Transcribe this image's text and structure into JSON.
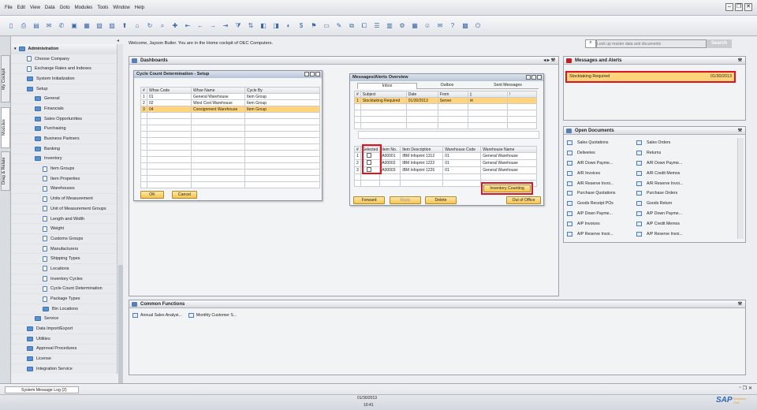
{
  "menu": [
    "File",
    "Edit",
    "View",
    "Data",
    "Goto",
    "Modules",
    "Tools",
    "Window",
    "Help"
  ],
  "side_tabs": [
    "My Cockpit",
    "Modules",
    "Drag & Relate"
  ],
  "sidebar": {
    "root": "Administration",
    "items": [
      {
        "label": "Choose Company",
        "type": "doc",
        "level": 1
      },
      {
        "label": "Exchange Rates and Indexes",
        "type": "doc",
        "level": 1
      },
      {
        "label": "System Initialization",
        "type": "folder",
        "level": 1
      },
      {
        "label": "Setup",
        "type": "folder",
        "level": 1
      },
      {
        "label": "General",
        "type": "folder",
        "level": 2
      },
      {
        "label": "Financials",
        "type": "folder",
        "level": 2
      },
      {
        "label": "Sales Opportunities",
        "type": "folder",
        "level": 2
      },
      {
        "label": "Purchasing",
        "type": "folder",
        "level": 2
      },
      {
        "label": "Business Partners",
        "type": "folder",
        "level": 2
      },
      {
        "label": "Banking",
        "type": "folder",
        "level": 2
      },
      {
        "label": "Inventory",
        "type": "folder",
        "level": 2
      },
      {
        "label": "Item Groups",
        "type": "doc",
        "level": 3
      },
      {
        "label": "Item Properties",
        "type": "doc",
        "level": 3
      },
      {
        "label": "Warehouses",
        "type": "doc",
        "level": 3
      },
      {
        "label": "Units of Measurement",
        "type": "doc",
        "level": 3
      },
      {
        "label": "Unit of Measurement Groups",
        "type": "doc",
        "level": 3
      },
      {
        "label": "Length and Width",
        "type": "doc",
        "level": 3
      },
      {
        "label": "Weight",
        "type": "doc",
        "level": 3
      },
      {
        "label": "Customs Groups",
        "type": "doc",
        "level": 3
      },
      {
        "label": "Manufacturers",
        "type": "doc",
        "level": 3
      },
      {
        "label": "Shipping Types",
        "type": "doc",
        "level": 3
      },
      {
        "label": "Locations",
        "type": "doc",
        "level": 3
      },
      {
        "label": "Inventory Cycles",
        "type": "doc",
        "level": 3
      },
      {
        "label": "Cycle Count Determination",
        "type": "doc",
        "level": 3
      },
      {
        "label": "Package Types",
        "type": "doc",
        "level": 3
      },
      {
        "label": "Bin Locations",
        "type": "folder",
        "level": 3
      },
      {
        "label": "Service",
        "type": "folder",
        "level": 2
      },
      {
        "label": "Data Import/Export",
        "type": "folder",
        "level": 1
      },
      {
        "label": "Utilities",
        "type": "folder",
        "level": 1
      },
      {
        "label": "Approval Procedures",
        "type": "folder",
        "level": 1
      },
      {
        "label": "License",
        "type": "folder",
        "level": 1
      },
      {
        "label": "Integration Service",
        "type": "folder",
        "level": 1
      }
    ]
  },
  "welcome": "Welcome, Jayson Butler. You are in the Home cockpit of OEC Computers.",
  "search": {
    "placeholder": "Look up master data and documents",
    "button": "Search"
  },
  "dashboards": {
    "title": "Dashboards"
  },
  "ccd": {
    "title": "Cycle Count Determination - Setup",
    "headers": [
      "#",
      "Whse Code",
      "Whse Name",
      "Cycle By"
    ],
    "rows": [
      [
        "1",
        "01",
        "General Warehouse",
        "Item Group"
      ],
      [
        "2",
        "02",
        "West Cost Warehouse",
        "Item Group"
      ],
      [
        "3",
        "04",
        "Consignment Warehouse",
        "Item Group"
      ]
    ],
    "ok": "OK",
    "cancel": "Cancel"
  },
  "mao": {
    "title": "Messages/Alerts Overview",
    "tabs": [
      "Inbox",
      "Outbox",
      "Sent Messages"
    ],
    "headers": [
      "#",
      "Subject",
      "Date",
      "From",
      "",
      ""
    ],
    "row": [
      "1",
      "Stocktaking Required",
      "01/30/2013",
      "Server"
    ],
    "items_headers": [
      "#",
      "Selected",
      "Item No.",
      "Item Description",
      "Warehouse Code",
      "Warehouse Name"
    ],
    "items": [
      [
        "1",
        "A00001",
        "IBM Infoprint 1312",
        "01",
        "General Warehouse"
      ],
      [
        "2",
        "A00002",
        "IBM Infoprint 1222",
        "01",
        "General Warehouse"
      ],
      [
        "3",
        "A00003",
        "IBM Infoprint 1226",
        "01",
        "General Warehouse"
      ]
    ],
    "inv_btn": "Inventory Counting",
    "forward": "Forward",
    "reply": "Reply",
    "delete": "Delete",
    "ooo": "Out of Office"
  },
  "alerts": {
    "title": "Messages and Alerts",
    "item": "Stocktaking Required",
    "date": "01/30/2013"
  },
  "opendocs": {
    "title": "Open Documents",
    "left": [
      "Sales Quotations",
      "Deliveries",
      "A/R Down Payme...",
      "A/R Invoices",
      "A/R Reserve Invoi...",
      "Purchase Quotations",
      "Goods Receipt POs",
      "A/P Down Payme...",
      "A/P Invoices",
      "A/P Reserve Invoi..."
    ],
    "right": [
      "Sales Orders",
      "Returns",
      "A/R Down Payme...",
      "A/R Credit Memos",
      "A/R Reserve Invoi...",
      "Purchase Orders",
      "Goods Return",
      "A/P Down Payme...",
      "A/P Credit Memos",
      "A/P Reserve Invoi..."
    ]
  },
  "common": {
    "title": "Common Functions",
    "items": [
      "Annual Sales Analysi...",
      "Monthly Customer S..."
    ]
  },
  "status": {
    "log": "System Message Log (2)",
    "date": "01/30/2013",
    "time": "10:41",
    "brand": "SAP",
    "brand2": "Business One"
  }
}
